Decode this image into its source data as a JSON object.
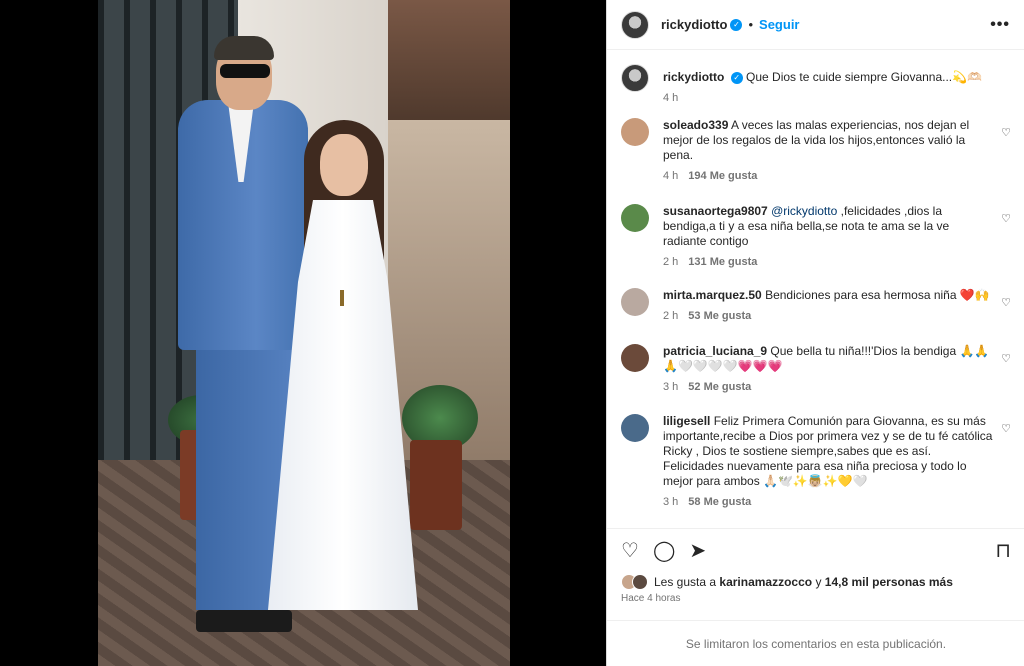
{
  "header": {
    "username": "rickydiotto",
    "separator": "•",
    "follow_label": "Seguir",
    "more_label": "•••"
  },
  "caption": {
    "username": "rickydiotto",
    "text": "Que Dios te cuide siempre Giovanna...💫🫶🏻",
    "time": "4 h"
  },
  "comments": [
    {
      "username": "soleado339",
      "text": "A veces las malas experiencias, nos dejan el mejor de los regalos de la vida los hijos,entonces valió la pena.",
      "time": "4 h",
      "likes": "194 Me gusta",
      "avatar_color": "#c89a7a"
    },
    {
      "username": "susanaortega9807",
      "mention": "@rickydiotto",
      "text": ",felicidades ,dios la bendiga,a ti y a esa niña bella,se nota te ama se la ve radiante contigo",
      "time": "2 h",
      "likes": "131 Me gusta",
      "avatar_color": "#5a8a4a"
    },
    {
      "username": "mirta.marquez.50",
      "text": "Bendiciones para esa hermosa niña ❤️🙌",
      "time": "2 h",
      "likes": "53 Me gusta",
      "avatar_color": "#b9a9a0"
    },
    {
      "username": "patricia_luciana_9",
      "text": "Que bella tu niña!!!'Dios la bendiga 🙏🙏🙏🤍🤍🤍🤍💗💗💗",
      "time": "3 h",
      "likes": "52 Me gusta",
      "avatar_color": "#6b4a3a"
    },
    {
      "username": "liligesell",
      "text": "Feliz Primera Comunión para Giovanna, es su más importante,recibe a Dios por primera vez y se de tu fé católica Ricky , Dios te sostiene siempre,sabes que es así. Felicidades nuevamente para esa niña preciosa y todo lo mejor para ambos 🙏🏻🕊️✨👼🏼✨💛🤍",
      "time": "3 h",
      "likes": "58 Me gusta",
      "avatar_color": "#4a6a8a"
    }
  ],
  "like_icon": "♡",
  "actions": {
    "like_icon": "♡",
    "comment_icon": "◯",
    "share_icon": "➤",
    "save_icon": "⊓"
  },
  "likes_summary": {
    "prefix": "Les gusta a",
    "user": "karinamazzocco",
    "middle": "y",
    "count": "14,8 mil personas más"
  },
  "post_time": "Hace 4 horas",
  "footer_text": "Se limitaron los comentarios en esta publicación."
}
